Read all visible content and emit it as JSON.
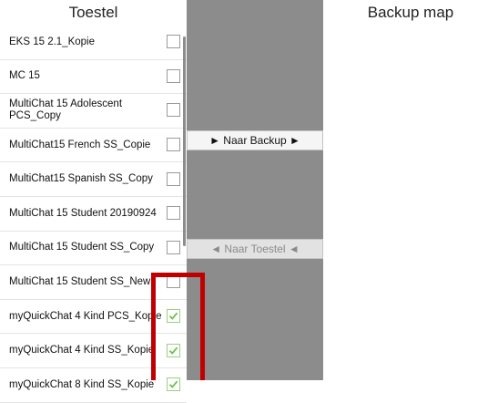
{
  "left_header": "Toestel",
  "right_header": "Backup map",
  "colors": {
    "middle_panel": "#8c8c8c",
    "highlight": "#c00000",
    "check": "#6cc04a"
  },
  "items": [
    {
      "label": "EKS 15 2.1_Kopie",
      "checked": false
    },
    {
      "label": "MC 15",
      "checked": false
    },
    {
      "label": "MultiChat 15 Adolescent PCS_Copy",
      "checked": false
    },
    {
      "label": "MultiChat15 French SS_Copie",
      "checked": false
    },
    {
      "label": "MultiChat15 Spanish SS_Copy",
      "checked": false
    },
    {
      "label": "MultiChat 15 Student 20190924",
      "checked": false
    },
    {
      "label": "MultiChat 15 Student SS_Copy",
      "checked": false
    },
    {
      "label": "MultiChat 15 Student SS_New",
      "checked": false
    },
    {
      "label": "myQuickChat 4 Kind PCS_Kopie",
      "checked": true
    },
    {
      "label": "myQuickChat 4 Kind SS_Kopie",
      "checked": true
    },
    {
      "label": "myQuickChat 8 Kind SS_Kopie",
      "checked": true
    }
  ],
  "buttons": {
    "to_backup": "► Naar Backup ►",
    "to_device": "◄ Naar Toestel ◄"
  }
}
